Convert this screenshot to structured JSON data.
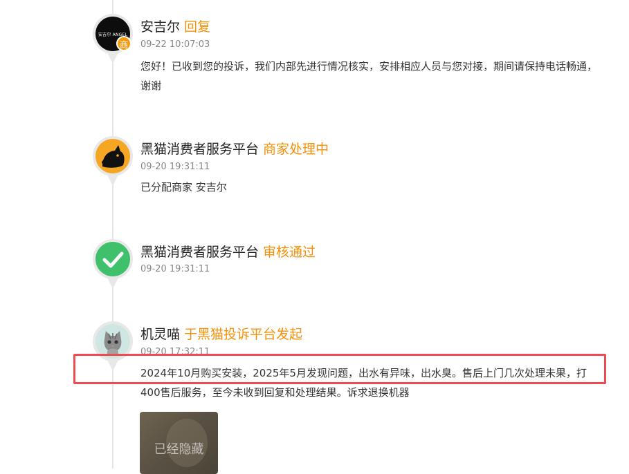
{
  "timeline": [
    {
      "author": "安吉尔",
      "status": "回复",
      "time": "09-22 10:07:03",
      "avatar_text": "安吉尔 ANGEL",
      "badge": "商",
      "content": "您好！已收到您的投诉，我们内部先进行情况核实，安排相应人员与您对接，期间请保持电话畅通，谢谢"
    },
    {
      "author": "黑猫消费者服务平台",
      "status": "商家处理中",
      "time": "09-20 19:31:11",
      "content": "已分配商家 安吉尔"
    },
    {
      "author": "黑猫消费者服务平台",
      "status": "审核通过",
      "time": "09-20 19:31:11"
    },
    {
      "author": "机灵喵",
      "status": "于黑猫投诉平台发起",
      "time": "09-20 17:32:11",
      "content": "2024年10月购买安装，2025年5月发现问题，出水有异味，出水臭。售后上门几次处理未果，打400售后服务，至今未收到回复和处理结果。诉求退换机器",
      "attachment_label": "已经隐藏"
    }
  ],
  "colors": {
    "status_orange": "#f5900b",
    "highlight_red": "#ee4b52",
    "check_green": "#3fc06b"
  }
}
